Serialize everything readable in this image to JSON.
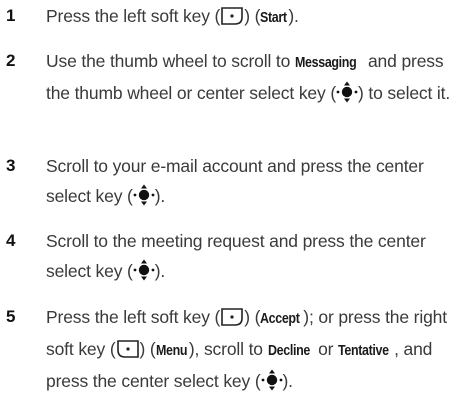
{
  "steps": [
    {
      "number": "1",
      "parts": [
        {
          "t": "text",
          "v": "Press the left soft key ("
        },
        {
          "t": "icon",
          "v": "left-soft-key-icon"
        },
        {
          "t": "text",
          "v": ") ("
        },
        {
          "t": "bold",
          "v": "Start"
        },
        {
          "t": "text",
          "v": ")."
        }
      ]
    },
    {
      "number": "2",
      "parts": [
        {
          "t": "text",
          "v": "Use the thumb wheel to scroll to "
        },
        {
          "t": "bold",
          "v": "Messaging"
        },
        {
          "t": "text",
          "v": " and press the thumb wheel or center select key ("
        },
        {
          "t": "icon",
          "v": "center-select-key-icon"
        },
        {
          "t": "text",
          "v": ") to select it."
        }
      ]
    },
    {
      "number": "3",
      "parts": [
        {
          "t": "text",
          "v": "Scroll to your e-mail account and press the center select key ("
        },
        {
          "t": "icon",
          "v": "center-select-key-icon"
        },
        {
          "t": "text",
          "v": ")."
        }
      ]
    },
    {
      "number": "4",
      "parts": [
        {
          "t": "text",
          "v": "Scroll to the meeting request and press the center select key ("
        },
        {
          "t": "icon",
          "v": "center-select-key-icon"
        },
        {
          "t": "text",
          "v": ")."
        }
      ]
    },
    {
      "number": "5",
      "parts": [
        {
          "t": "text",
          "v": "Press the left soft key ("
        },
        {
          "t": "icon",
          "v": "left-soft-key-icon"
        },
        {
          "t": "text",
          "v": ") ("
        },
        {
          "t": "bold",
          "v": "Accept"
        },
        {
          "t": "text",
          "v": "); or press the right soft key ("
        },
        {
          "t": "icon",
          "v": "right-soft-key-icon"
        },
        {
          "t": "text",
          "v": ") ("
        },
        {
          "t": "bold",
          "v": "Menu"
        },
        {
          "t": "text",
          "v": "), scroll to "
        },
        {
          "t": "bold",
          "v": "Decline"
        },
        {
          "t": "text",
          "v": " or "
        },
        {
          "t": "bold",
          "v": "Tentative"
        },
        {
          "t": "text",
          "v": ", and press the center select key ("
        },
        {
          "t": "icon",
          "v": "center-select-key-icon"
        },
        {
          "t": "text",
          "v": ")."
        }
      ]
    }
  ]
}
